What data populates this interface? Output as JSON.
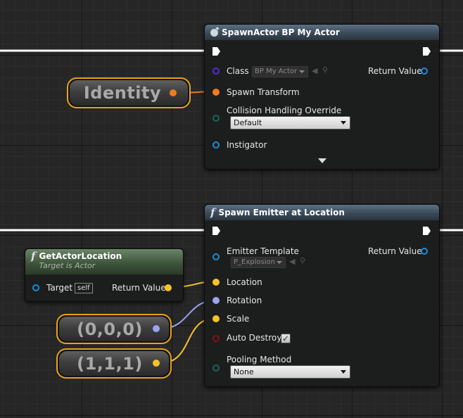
{
  "colors": {
    "exec": "#ffffff",
    "transform": "#f07a1e",
    "vector": "#f5c22b",
    "rotator": "#9aa4f0",
    "object": "#1e8ad6",
    "class": "#5a2bd0",
    "enum": "#17665a",
    "bool": "#8c0e0e",
    "variable_border": "#e8a21a"
  },
  "spawn_actor": {
    "title": "SpawnActor BP My Actor",
    "icon": "bomb-icon",
    "class_label": "Class",
    "class_value": "BP My Actor",
    "return_value_label": "Return Value",
    "spawn_transform_label": "Spawn Transform",
    "collision_label": "Collision Handling Override",
    "collision_value": "Default",
    "instigator_label": "Instigator"
  },
  "identity_node": {
    "label": "Identity"
  },
  "spawn_emitter": {
    "title": "Spawn Emitter at Location",
    "icon": "function-icon",
    "emitter_template_label": "Emitter Template",
    "emitter_template_value": "P_Explosion",
    "return_value_label": "Return Value",
    "location_label": "Location",
    "rotation_label": "Rotation",
    "scale_label": "Scale",
    "auto_destroy_label": "Auto Destroy",
    "auto_destroy_checked": true,
    "pooling_label": "Pooling Method",
    "pooling_value": "None"
  },
  "get_actor_location": {
    "title": "GetActorLocation",
    "subtitle": "Target is Actor",
    "target_label": "Target",
    "target_default": "self",
    "return_value_label": "Return Value"
  },
  "zero_vector_node": {
    "label": "(0,0,0)"
  },
  "one_vector_node": {
    "label": "(1,1,1)"
  }
}
